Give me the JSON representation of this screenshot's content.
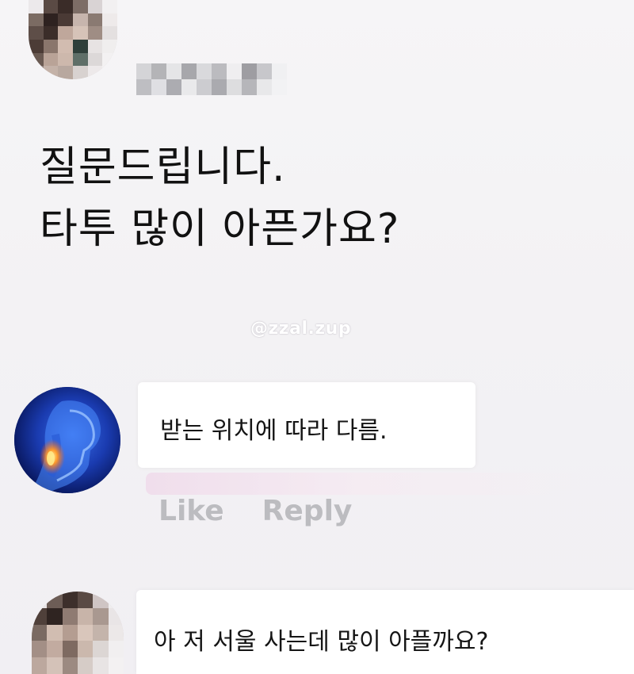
{
  "post": {
    "avatar_icon": "pixelated-avatar-icon",
    "author": "",
    "text_line1": "질문드립니다.",
    "text_line2": "타투 많이 아픈가요?"
  },
  "watermark": "@zzal.zup",
  "comments": [
    {
      "avatar_icon": "throat-xray-avatar-icon",
      "text": "받는 위치에 따라 다름.",
      "like_label": "Like",
      "reply_label": "Reply"
    },
    {
      "avatar_icon": "pixelated-avatar-icon",
      "text": "아 저 서울 사는데 많이 아플까요?"
    }
  ],
  "colors": {
    "background": "#f4f3f5",
    "bubble": "#ffffff",
    "action_text": "#bcbcc0",
    "avatar_blue": "#0b1e6e"
  }
}
